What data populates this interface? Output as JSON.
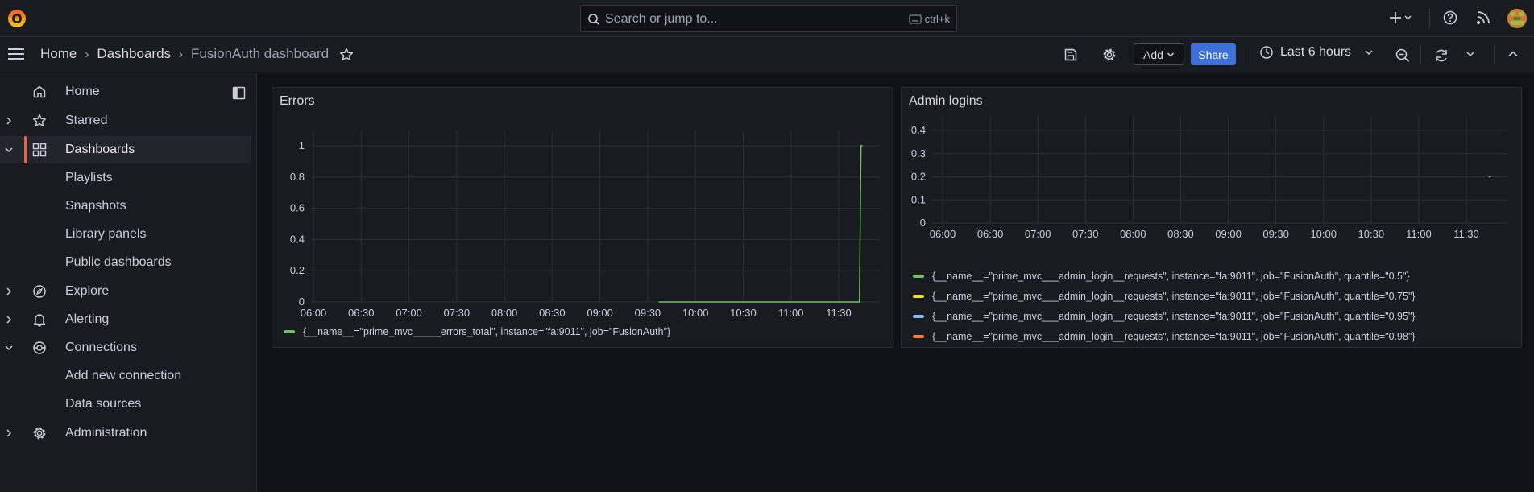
{
  "search": {
    "placeholder": "Search or jump to...",
    "shortcut": "ctrl+k"
  },
  "breadcrumb": {
    "home": "Home",
    "dashboards": "Dashboards",
    "current": "FusionAuth dashboard"
  },
  "toolbar": {
    "add_label": "Add",
    "share_label": "Share",
    "time_range": "Last 6 hours"
  },
  "sidebar": {
    "items": [
      {
        "label": "Home",
        "icon": "home-icon"
      },
      {
        "label": "Starred",
        "icon": "star-icon"
      },
      {
        "label": "Dashboards",
        "icon": "apps-icon"
      },
      {
        "label": "Explore",
        "icon": "compass-icon"
      },
      {
        "label": "Alerting",
        "icon": "bell-icon"
      },
      {
        "label": "Connections",
        "icon": "link-icon"
      },
      {
        "label": "Administration",
        "icon": "gear-icon"
      }
    ],
    "dashboards_children": [
      "Playlists",
      "Snapshots",
      "Library panels",
      "Public dashboards"
    ],
    "connections_children": [
      "Add new connection",
      "Data sources"
    ]
  },
  "panels": {
    "errors": {
      "title": "Errors",
      "legend": [
        {
          "label": "{__name__=\"prime_mvc_____errors_total\", instance=\"fa:9011\", job=\"FusionAuth\"}",
          "color": "#73bf69"
        }
      ]
    },
    "admin": {
      "title": "Admin logins",
      "legend": [
        {
          "label": "{__name__=\"prime_mvc___admin_login__requests\", instance=\"fa:9011\", job=\"FusionAuth\", quantile=\"0.5\"}",
          "color": "#73bf69"
        },
        {
          "label": "{__name__=\"prime_mvc___admin_login__requests\", instance=\"fa:9011\", job=\"FusionAuth\", quantile=\"0.75\"}",
          "color": "#fade2a"
        },
        {
          "label": "{__name__=\"prime_mvc___admin_login__requests\", instance=\"fa:9011\", job=\"FusionAuth\", quantile=\"0.95\"}",
          "color": "#8ab8ff"
        },
        {
          "label": "{__name__=\"prime_mvc___admin_login__requests\", instance=\"fa:9011\", job=\"FusionAuth\", quantile=\"0.98\"}",
          "color": "#ff7f3e"
        }
      ]
    }
  },
  "chart_data": [
    {
      "type": "line",
      "title": "Errors",
      "x": [
        "06:00",
        "06:30",
        "07:00",
        "07:30",
        "08:00",
        "08:30",
        "09:00",
        "09:30",
        "10:00",
        "10:30",
        "11:00",
        "11:30"
      ],
      "y_ticks": [
        0,
        0.2,
        0.4,
        0.6,
        0.8,
        1
      ],
      "ylim": [
        0,
        1
      ],
      "grid": true,
      "legend_position": "bottom",
      "series": [
        {
          "name": "{__name__=\"prime_mvc_____errors_total\", instance=\"fa:9011\", job=\"FusionAuth\"}",
          "points": [
            [
              "09:37",
              0
            ],
            [
              "11:43",
              0
            ],
            [
              "11:44",
              1
            ],
            [
              "11:45",
              1
            ]
          ]
        }
      ]
    },
    {
      "type": "line",
      "title": "Admin logins",
      "x": [
        "06:00",
        "06:30",
        "07:00",
        "07:30",
        "08:00",
        "08:30",
        "09:00",
        "09:30",
        "10:00",
        "10:30",
        "11:00",
        "11:30"
      ],
      "y_ticks": [
        0,
        0.1,
        0.2,
        0.3,
        0.4
      ],
      "ylim": [
        0,
        0.4
      ],
      "grid": true,
      "legend_position": "bottom",
      "series": [
        {
          "name": "{__name__=\"prime_mvc___admin_login__requests\", instance=\"fa:9011\", job=\"FusionAuth\", quantile=\"0.5\"}",
          "points": [
            [
              "11:45",
              0.2
            ]
          ]
        },
        {
          "name": "{__name__=\"prime_mvc___admin_login__requests\", instance=\"fa:9011\", job=\"FusionAuth\", quantile=\"0.75\"}",
          "points": []
        },
        {
          "name": "{__name__=\"prime_mvc___admin_login__requests\", instance=\"fa:9011\", job=\"FusionAuth\", quantile=\"0.95\"}",
          "points": []
        },
        {
          "name": "{__name__=\"prime_mvc___admin_login__requests\", instance=\"fa:9011\", job=\"FusionAuth\", quantile=\"0.98\"}",
          "points": []
        }
      ]
    }
  ]
}
